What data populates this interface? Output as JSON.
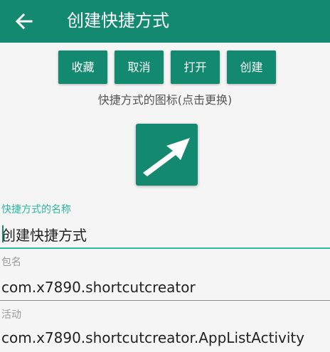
{
  "colors": {
    "primary": "#138a6f",
    "accent": "#2bb99e"
  },
  "app_bar": {
    "title": "创建快捷方式",
    "back_icon": "arrow-left-icon"
  },
  "actions": {
    "favorite_label": "收藏",
    "cancel_label": "取消",
    "open_label": "打开",
    "create_label": "创建"
  },
  "icon_hint": "快捷方式的图标(点击更换)",
  "shortcut_icon": "diagonal-arrow-icon",
  "fields": {
    "name": {
      "label": "快捷方式的名称",
      "value": "创建快捷方式"
    },
    "package": {
      "label": "包名",
      "value": "com.x7890.shortcutcreator"
    },
    "activity": {
      "label": "活动",
      "value": "com.x7890.shortcutcreator.AppListActivity"
    }
  }
}
